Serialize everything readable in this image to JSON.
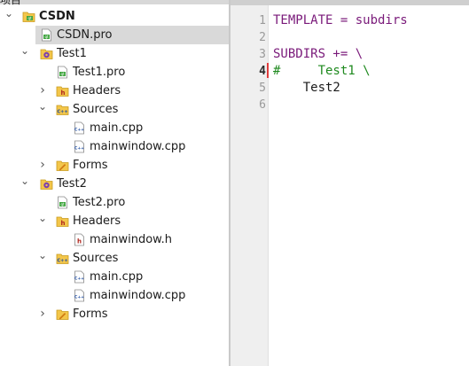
{
  "tree_header": {
    "label": "项目"
  },
  "tree": [
    {
      "label": "CSDN",
      "icon": "qt-project-folder-icon",
      "arrow": "down",
      "depth": 0,
      "bold": true,
      "selected": false
    },
    {
      "label": "CSDN.pro",
      "icon": "pro-file-icon",
      "arrow": "",
      "depth": 1,
      "bold": false,
      "selected": true
    },
    {
      "label": "Test1",
      "icon": "subproject-gear-icon",
      "arrow": "down",
      "depth": 1,
      "bold": false,
      "selected": false
    },
    {
      "label": "Test1.pro",
      "icon": "pro-file-icon",
      "arrow": "",
      "depth": 2,
      "bold": false,
      "selected": false
    },
    {
      "label": "Headers",
      "icon": "headers-folder-icon",
      "arrow": "right",
      "depth": 2,
      "bold": false,
      "selected": false
    },
    {
      "label": "Sources",
      "icon": "sources-folder-icon",
      "arrow": "down",
      "depth": 2,
      "bold": false,
      "selected": false
    },
    {
      "label": "main.cpp",
      "icon": "cpp-file-icon",
      "arrow": "",
      "depth": 3,
      "bold": false,
      "selected": false
    },
    {
      "label": "mainwindow.cpp",
      "icon": "cpp-file-icon",
      "arrow": "",
      "depth": 3,
      "bold": false,
      "selected": false
    },
    {
      "label": "Forms",
      "icon": "forms-folder-icon",
      "arrow": "right",
      "depth": 2,
      "bold": false,
      "selected": false
    },
    {
      "label": "Test2",
      "icon": "subproject-gear-icon",
      "arrow": "down",
      "depth": 1,
      "bold": false,
      "selected": false
    },
    {
      "label": "Test2.pro",
      "icon": "pro-file-icon",
      "arrow": "",
      "depth": 2,
      "bold": false,
      "selected": false
    },
    {
      "label": "Headers",
      "icon": "headers-folder-icon",
      "arrow": "down",
      "depth": 2,
      "bold": false,
      "selected": false
    },
    {
      "label": "mainwindow.h",
      "icon": "header-file-icon",
      "arrow": "",
      "depth": 3,
      "bold": false,
      "selected": false
    },
    {
      "label": "Sources",
      "icon": "sources-folder-icon",
      "arrow": "down",
      "depth": 2,
      "bold": false,
      "selected": false
    },
    {
      "label": "main.cpp",
      "icon": "cpp-file-icon",
      "arrow": "",
      "depth": 3,
      "bold": false,
      "selected": false
    },
    {
      "label": "mainwindow.cpp",
      "icon": "cpp-file-icon",
      "arrow": "",
      "depth": 3,
      "bold": false,
      "selected": false
    },
    {
      "label": "Forms",
      "icon": "forms-folder-icon",
      "arrow": "right",
      "depth": 2,
      "bold": false,
      "selected": false
    }
  ],
  "editor": {
    "current_line": 4,
    "lines": [
      {
        "n": "1",
        "text": "TEMPLATE = subdirs",
        "color": "#7a1a7a"
      },
      {
        "n": "2",
        "text": "",
        "color": "#7a1a7a"
      },
      {
        "n": "3",
        "text": "SUBDIRS += \\",
        "color": "#7a1a7a"
      },
      {
        "n": "4",
        "text": "#     Test1 \\",
        "color": "#1f8a1f"
      },
      {
        "n": "5",
        "text": "    Test2",
        "color": "#1b1b1b"
      },
      {
        "n": "6",
        "text": "",
        "color": "#1b1b1b"
      }
    ]
  },
  "colors": {
    "selection": "#d9d9d9",
    "gutter": "#efefef",
    "keyword": "#7a1a7a",
    "comment": "#1f8a1f",
    "current_line_marker": "#e03c3c"
  }
}
